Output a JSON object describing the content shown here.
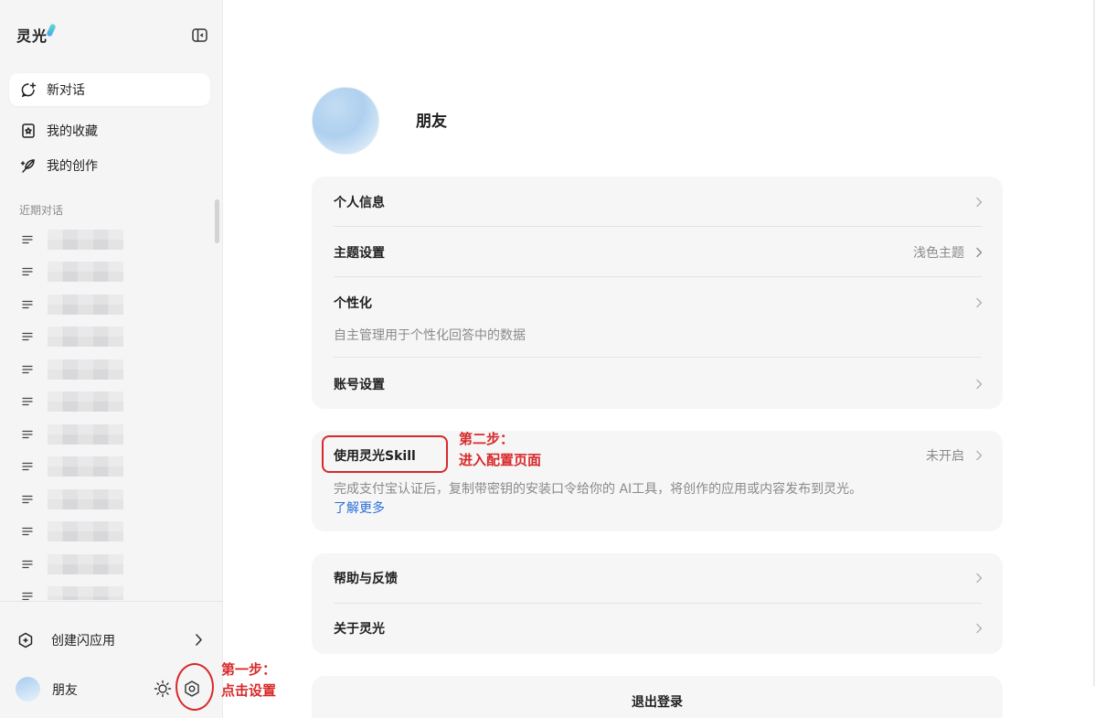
{
  "sidebar": {
    "logo_text": "灵光",
    "nav": {
      "new_chat": "新对话",
      "favorites": "我的收藏",
      "creations": "我的创作"
    },
    "recent_label": "近期对话",
    "history_count": 12,
    "create_app": "创建闪应用",
    "user_name": "朋友"
  },
  "profile": {
    "name": "朋友"
  },
  "settings": {
    "personal_info": "个人信息",
    "theme": "主题设置",
    "theme_value": "浅色主题",
    "personalization": "个性化",
    "personalization_desc": "自主管理用于个性化回答中的数据",
    "account": "账号设置",
    "skill": "使用灵光Skill",
    "skill_status": "未开启",
    "skill_desc": "完成支付宝认证后，复制带密钥的安装口令给你的 AI工具，将创作的应用或内容发布到灵光。",
    "learn_more": "了解更多",
    "help": "帮助与反馈",
    "about": "关于灵光",
    "logout": "退出登录"
  },
  "annotations": {
    "step1_line1": "第一步：",
    "step1_line2": "点击设置",
    "step2_line1": "第二步：",
    "step2_line2": "进入配置页面"
  },
  "colors": {
    "annotation_red": "#d8292a",
    "link_blue": "#2b6fd6",
    "sidebar_bg": "#f5f5f6",
    "card_bg": "#f6f6f7"
  }
}
